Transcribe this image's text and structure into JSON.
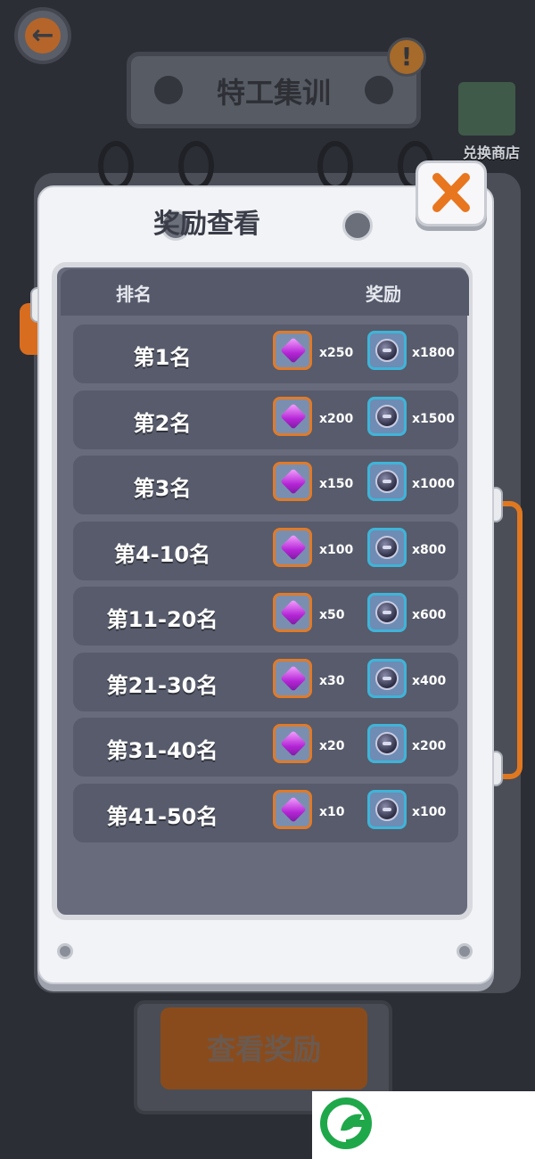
{
  "background": {
    "title": "特工集训",
    "alert": "!",
    "shop_label": "兑换商店",
    "button_label": "查看奖励"
  },
  "modal": {
    "title": "奖励查看",
    "header": {
      "rank": "排名",
      "reward": "奖励"
    },
    "rows": [
      {
        "rank": "第1名",
        "gem": "x250",
        "coin": "x1800"
      },
      {
        "rank": "第2名",
        "gem": "x200",
        "coin": "x1500"
      },
      {
        "rank": "第3名",
        "gem": "x150",
        "coin": "x1000"
      },
      {
        "rank": "第4-10名",
        "gem": "x100",
        "coin": "x800"
      },
      {
        "rank": "第11-20名",
        "gem": "x50",
        "coin": "x600"
      },
      {
        "rank": "第21-30名",
        "gem": "x30",
        "coin": "x400"
      },
      {
        "rank": "第31-40名",
        "gem": "x20",
        "coin": "x200"
      },
      {
        "rank": "第41-50名",
        "gem": "x10",
        "coin": "x100"
      }
    ]
  },
  "icons": {
    "back": "back-arrow-icon",
    "close": "close-x-icon",
    "gem": "purple-gem-icon",
    "coin": "token-coin-icon"
  },
  "colors": {
    "accent_orange": "#e07b2a",
    "gem_frame": "#e07b2a",
    "coin_frame": "#3fb4d8",
    "panel": "#676b7c",
    "row": "#575b6b",
    "logo_green": "#1fa84a"
  }
}
